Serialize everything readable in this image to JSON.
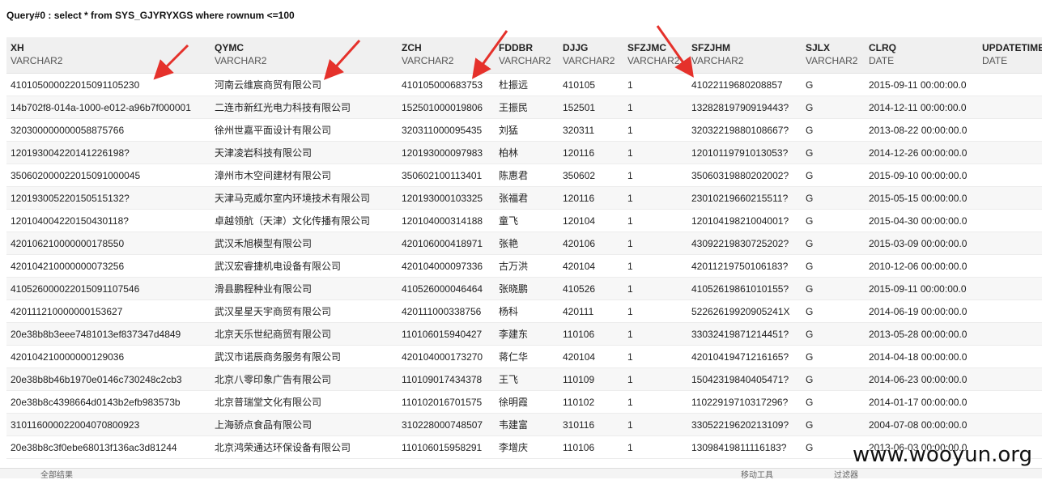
{
  "query_title": "Query#0 : select * from SYS_GJYRYXGS where rownum <=100",
  "columns": [
    {
      "name": "XH",
      "type": "VARCHAR2"
    },
    {
      "name": "QYMC",
      "type": "VARCHAR2"
    },
    {
      "name": "ZCH",
      "type": "VARCHAR2"
    },
    {
      "name": "FDDBR",
      "type": "VARCHAR2"
    },
    {
      "name": "DJJG",
      "type": "VARCHAR2"
    },
    {
      "name": "SFZJMC",
      "type": "VARCHAR2"
    },
    {
      "name": "SFZJHM",
      "type": "VARCHAR2"
    },
    {
      "name": "SJLX",
      "type": "VARCHAR2"
    },
    {
      "name": "CLRQ",
      "type": "DATE"
    },
    {
      "name": "UPDATETIME",
      "type": "DATE"
    }
  ],
  "rows": [
    [
      "410105000022015091105230",
      "河南云维宸商贸有限公司",
      "410105000683753",
      "杜振远",
      "410105",
      "1",
      "41022119680208857",
      "G",
      "2015-09-11 00:00:00.0",
      ""
    ],
    [
      "14b702f8-014a-1000-e012-a96b7f000001",
      "二连市新红光电力科技有限公司",
      "152501000019806",
      "王振民",
      "152501",
      "1",
      "13282819790919443?",
      "G",
      "2014-12-11 00:00:00.0",
      ""
    ],
    [
      "320300000000058875766",
      "徐州世嘉平面设计有限公司",
      "320311000095435",
      "刘猛",
      "320311",
      "1",
      "32032219880108667?",
      "G",
      "2013-08-22 00:00:00.0",
      ""
    ],
    [
      "120193004220141226198?",
      "天津凌岩科技有限公司",
      "120193000097983",
      "柏林",
      "120116",
      "1",
      "12010119791013053?",
      "G",
      "2014-12-26 00:00:00.0",
      ""
    ],
    [
      "350602000022015091000045",
      "漳州市木空间建材有限公司",
      "350602100113401",
      "陈惠君",
      "350602",
      "1",
      "35060319880202002?",
      "G",
      "2015-09-10 00:00:00.0",
      ""
    ],
    [
      "120193005220150515132?",
      "天津马克威尔室内环境技术有限公司",
      "120193000103325",
      "张福君",
      "120116",
      "1",
      "23010219660215511?",
      "G",
      "2015-05-15 00:00:00.0",
      ""
    ],
    [
      "120104004220150430118?",
      "卓越领航（天津）文化传播有限公司",
      "120104000314188",
      "童飞",
      "120104",
      "1",
      "12010419821004001?",
      "G",
      "2015-04-30 00:00:00.0",
      ""
    ],
    [
      "420106210000000178550",
      "武汉禾旭模型有限公司",
      "420106000418971",
      "张艳",
      "420106",
      "1",
      "43092219830725202?",
      "G",
      "2015-03-09 00:00:00.0",
      ""
    ],
    [
      "420104210000000073256",
      "武汉宏睿捷机电设备有限公司",
      "420104000097336",
      "古万洪",
      "420104",
      "1",
      "42011219750106183?",
      "G",
      "2010-12-06 00:00:00.0",
      ""
    ],
    [
      "410526000022015091107546",
      "滑县鹏程种业有限公司",
      "410526000046464",
      "张晓鹏",
      "410526",
      "1",
      "41052619861010155?",
      "G",
      "2015-09-11 00:00:00.0",
      ""
    ],
    [
      "420111210000000153627",
      "武汉星星天宇商贸有限公司",
      "420111000338756",
      "杨科",
      "420111",
      "1",
      "52262619920905241X",
      "G",
      "2014-06-19 00:00:00.0",
      ""
    ],
    [
      "20e38b8b3eee7481013ef837347d4849",
      "北京天乐世纪商贸有限公司",
      "110106015940427",
      "李建东",
      "110106",
      "1",
      "33032419871214451?",
      "G",
      "2013-05-28 00:00:00.0",
      ""
    ],
    [
      "420104210000000129036",
      "武汉市诺辰商务服务有限公司",
      "420104000173270",
      "蒋仁华",
      "420104",
      "1",
      "42010419471216165?",
      "G",
      "2014-04-18 00:00:00.0",
      ""
    ],
    [
      "20e38b8b46b1970e0146c730248c2cb3",
      "北京八零印象广告有限公司",
      "110109017434378",
      "王飞",
      "110109",
      "1",
      "15042319840405471?",
      "G",
      "2014-06-23 00:00:00.0",
      ""
    ],
    [
      "20e38b8c4398664d0143b2efb983573b",
      "北京普瑞堂文化有限公司",
      "110102016701575",
      "徐明霞",
      "110102",
      "1",
      "11022919710317296?",
      "G",
      "2014-01-17 00:00:00.0",
      ""
    ],
    [
      "310116000022004070800923",
      "上海骄点食品有限公司",
      "310228000748507",
      "韦建富",
      "310116",
      "1",
      "33052219620213109?",
      "G",
      "2004-07-08 00:00:00.0",
      ""
    ],
    [
      "20e38b8c3f0ebe68013f136ac3d81244",
      "北京鸿荣通达环保设备有限公司",
      "110106015958291",
      "李增庆",
      "110106",
      "1",
      "13098419811116183?",
      "G",
      "2013-06-03 00:00:00.0",
      ""
    ]
  ],
  "watermark": "www.wooyun.org",
  "status_bar": {
    "left": "全部结果",
    "mid": "移动工具",
    "right": "过滤器"
  },
  "colors": {
    "header_bg": "#f0f0f0",
    "zebra": "#f7f7f7",
    "arrow": "#e5312b"
  }
}
